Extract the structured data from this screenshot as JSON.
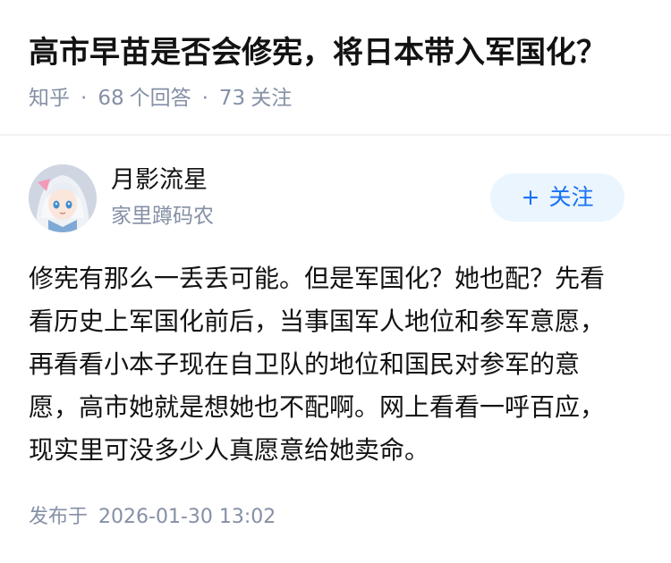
{
  "question": {
    "title": "高市早苗是否会修宪，将日本带入军国化？",
    "source": "知乎",
    "answer_count": "68",
    "answer_label": "个回答",
    "follower_count": "73",
    "follower_label": "关注",
    "separator": "·"
  },
  "author": {
    "name": "月影流星",
    "bio": "家里蹲码农",
    "avatar_icon": "anime-girl-avatar"
  },
  "follow_button": {
    "plus": "+",
    "label": "关注"
  },
  "answer": {
    "text": "修宪有那么一丢丢可能。但是军国化？她也配？先看看历史上军国化前后，当事国军人地位和参军意愿，再看看小本子现在自卫队的地位和国民对参军的意愿，高市她就是想她也不配啊。网上看看一呼百应，现实里可没多少人真愿意给她卖命。"
  },
  "publish": {
    "label": "发布于",
    "datetime": "2026-01-30 13:02"
  },
  "colors": {
    "text_primary": "#121212",
    "text_secondary": "#8590a6",
    "accent": "#1772f6",
    "button_bg": "#ebf5fd",
    "divider": "#f2f2f2"
  }
}
